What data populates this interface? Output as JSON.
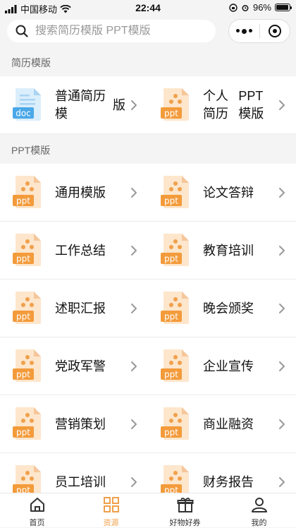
{
  "status": {
    "carrier": "中国移动",
    "time": "22:44",
    "battery": "96%",
    "battery_level": 0.96
  },
  "search": {
    "placeholder": "搜索简历模版 PPT模版"
  },
  "sections": [
    {
      "title": "简历模版",
      "items": [
        {
          "label": "普通简历模版",
          "icon": "doc",
          "line1": "普通简历模",
          "line2": "版"
        },
        {
          "label": "个人简历PPT模版",
          "icon": "ppt",
          "line1": "个人简历",
          "line2": "PPT模版"
        }
      ]
    },
    {
      "title": "PPT模版",
      "items": [
        {
          "label": "通用模版",
          "icon": "ppt"
        },
        {
          "label": "论文答辩",
          "icon": "ppt"
        },
        {
          "label": "工作总结",
          "icon": "ppt"
        },
        {
          "label": "教育培训",
          "icon": "ppt"
        },
        {
          "label": "述职汇报",
          "icon": "ppt"
        },
        {
          "label": "晚会颁奖",
          "icon": "ppt"
        },
        {
          "label": "党政军警",
          "icon": "ppt"
        },
        {
          "label": "企业宣传",
          "icon": "ppt"
        },
        {
          "label": "营销策划",
          "icon": "ppt"
        },
        {
          "label": "商业融资",
          "icon": "ppt"
        },
        {
          "label": "员工培训",
          "icon": "ppt"
        },
        {
          "label": "财务报告",
          "icon": "ppt"
        }
      ]
    }
  ],
  "icon_text": {
    "doc": "doc",
    "ppt": "ppt"
  },
  "tabs": [
    {
      "label": "首页",
      "icon": "home-icon",
      "active": false
    },
    {
      "label": "资源",
      "icon": "grid-icon",
      "active": true
    },
    {
      "label": "好物好券",
      "icon": "gift-icon",
      "active": false
    },
    {
      "label": "我的",
      "icon": "user-icon",
      "active": false
    }
  ],
  "colors": {
    "accent": "#f0a04b",
    "ppt_bg": "#fde6cc",
    "ppt_fold": "#f5c69a",
    "ppt_dot": "#f0a04b",
    "ppt_tag": "#f39b3b",
    "doc_bg": "#dbeefb",
    "doc_tag": "#4aa8e8",
    "doc_line": "#a9d4f3"
  }
}
